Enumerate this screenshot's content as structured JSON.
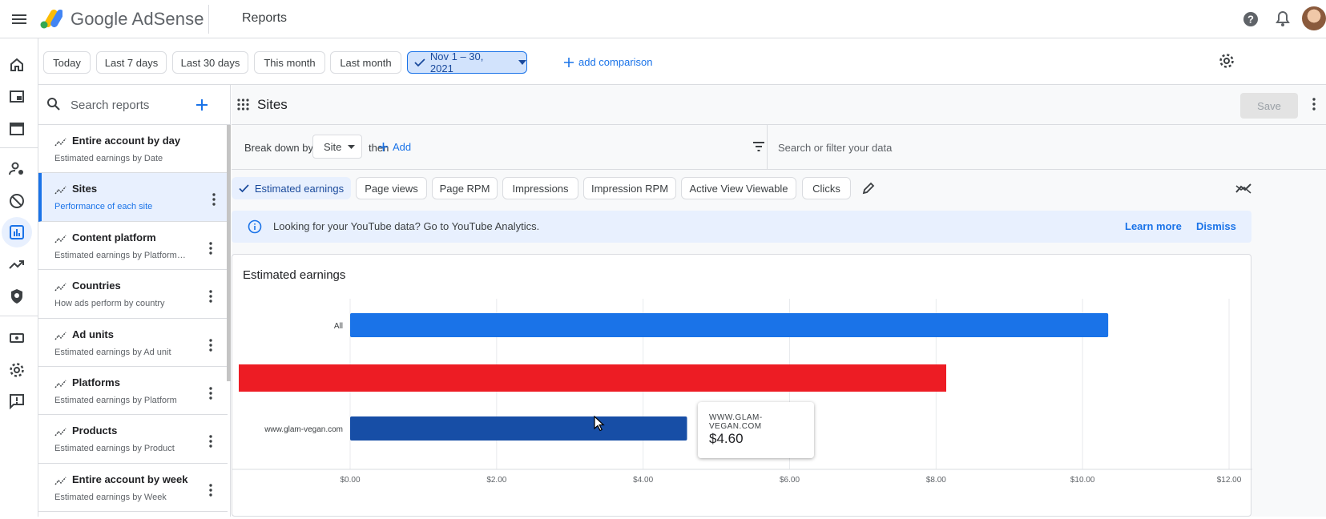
{
  "app": {
    "brand": "Google AdSense",
    "page_title": "Reports"
  },
  "date_chips": [
    "Today",
    "Last 7 days",
    "Last 30 days",
    "This month",
    "Last month"
  ],
  "date_selected": "Nov 1 – 30, 2021",
  "add_comparison": "add comparison",
  "search": {
    "placeholder": "Search reports"
  },
  "reports": [
    {
      "title": "Entire account by day",
      "subtitle": "Estimated earnings by Date"
    },
    {
      "title": "Sites",
      "subtitle": "Performance of each site"
    },
    {
      "title": "Content platform",
      "subtitle": "Estimated earnings by Platform…"
    },
    {
      "title": "Countries",
      "subtitle": "How ads perform by country"
    },
    {
      "title": "Ad units",
      "subtitle": "Estimated earnings by Ad unit"
    },
    {
      "title": "Platforms",
      "subtitle": "Estimated earnings by Platform"
    },
    {
      "title": "Products",
      "subtitle": "Estimated earnings by Product"
    },
    {
      "title": "Entire account by week",
      "subtitle": "Estimated earnings by Week"
    }
  ],
  "main": {
    "title": "Sites",
    "save": "Save",
    "break_down_by": "Break down by",
    "breakdown_value": "Site",
    "then": "then",
    "add": "Add",
    "filter_placeholder": "Search or filter your data"
  },
  "metrics": [
    "Estimated earnings",
    "Page views",
    "Page RPM",
    "Impressions",
    "Impression RPM",
    "Active View Viewable",
    "Clicks"
  ],
  "metric_selected": "Estimated earnings",
  "notice": {
    "text": "Looking for your YouTube data? Go to YouTube Analytics.",
    "learn_more": "Learn more",
    "dismiss": "Dismiss"
  },
  "colors": {
    "accent": "#1a73e8",
    "bar_all": "#1a73e8",
    "bar_site": "#174ea6",
    "overlay_red": "#ed1c24"
  },
  "chart_data": {
    "type": "bar",
    "orientation": "horizontal",
    "title": "Estimated earnings",
    "categories": [
      "All",
      "www.glam-vegan.com"
    ],
    "values": [
      10.35,
      4.6
    ],
    "xlim": [
      0,
      12
    ],
    "xticks": [
      "$0.00",
      "$2.00",
      "$4.00",
      "$6.00",
      "$8.00",
      "$10.00",
      "$12.00"
    ],
    "grid": true,
    "tooltip": {
      "label": "WWW.GLAM-VEGAN.COM",
      "value": "$4.60"
    }
  }
}
